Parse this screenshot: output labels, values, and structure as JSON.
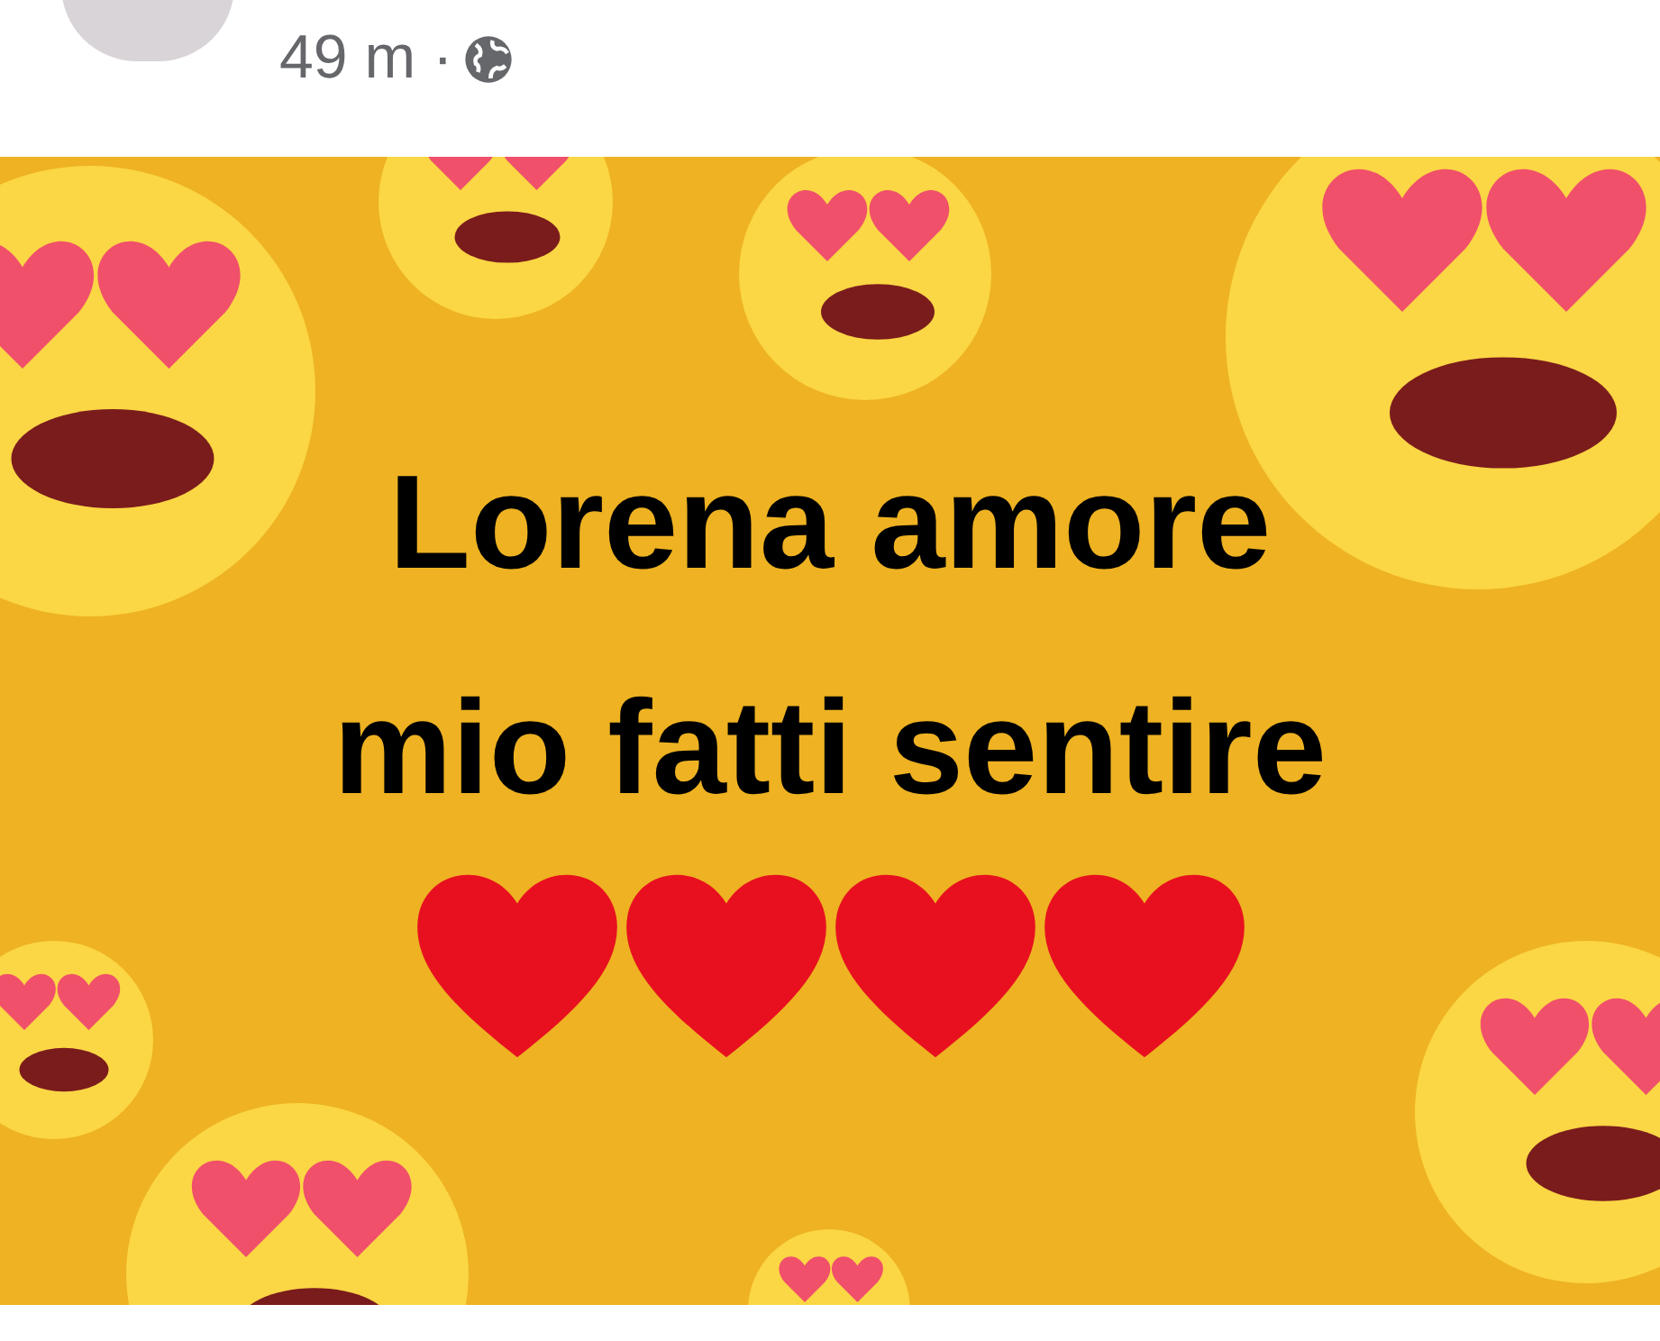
{
  "post": {
    "time": "49 m ·",
    "message_lines": [
      "Lorena amore",
      "mio fatti sentire"
    ]
  }
}
